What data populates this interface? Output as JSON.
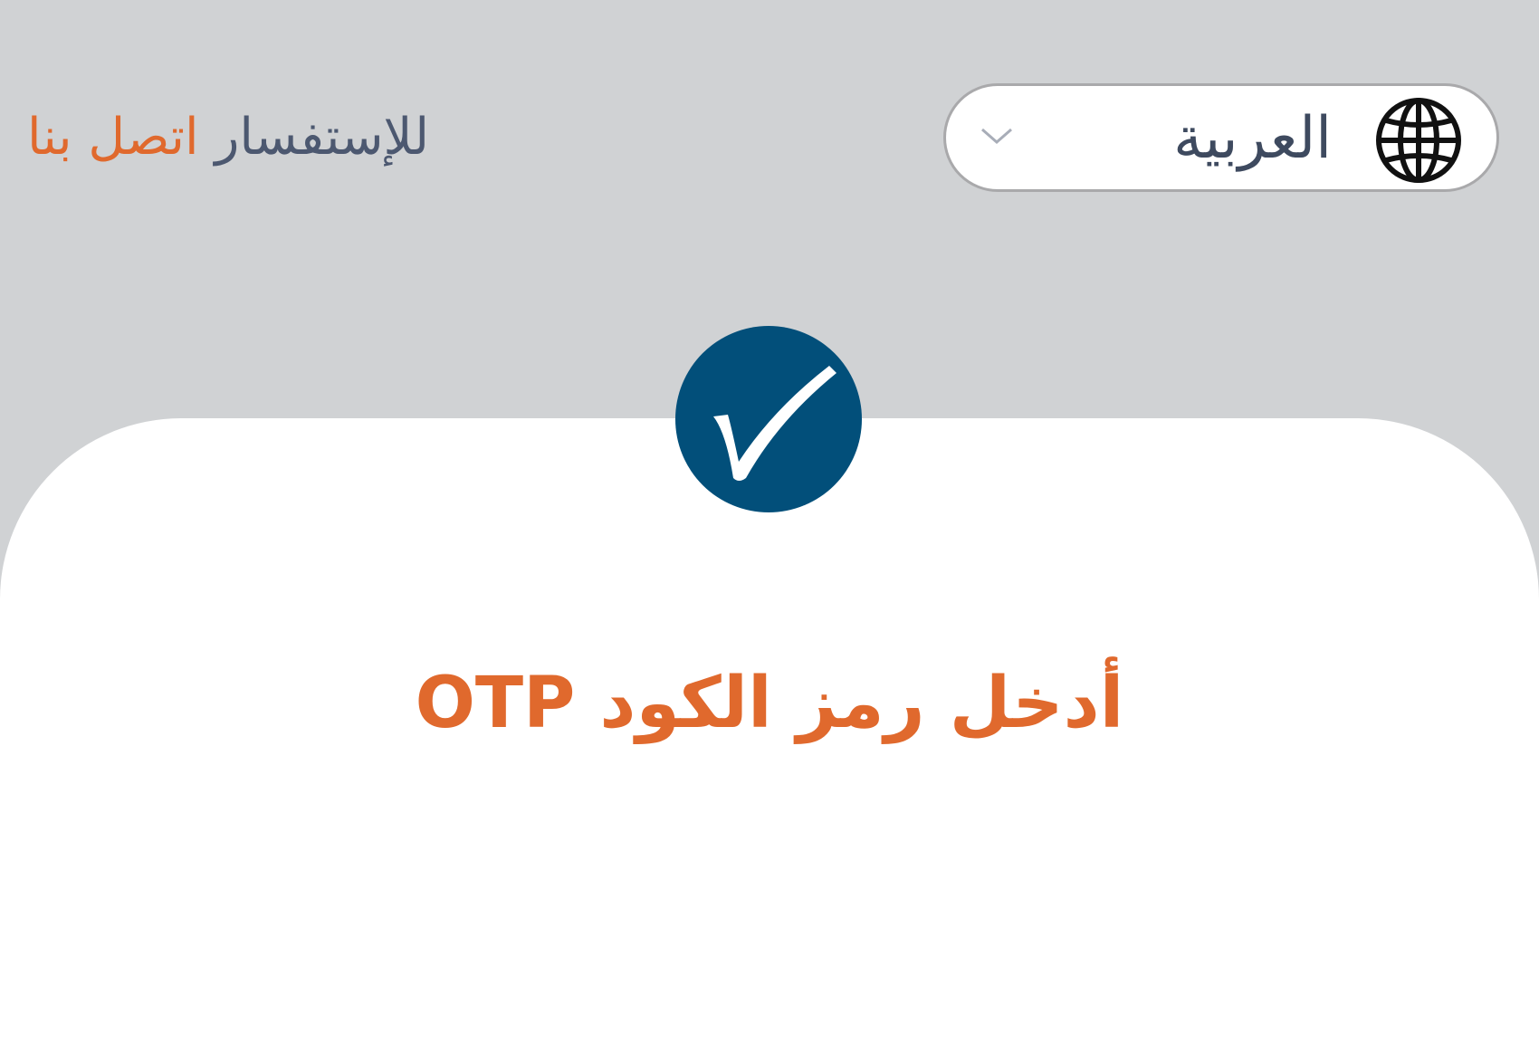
{
  "header": {
    "language_selector": {
      "selected_label": "العربية",
      "globe_icon": "globe-icon",
      "dropdown_icon": "chevron-down-icon"
    },
    "contact": {
      "prefix_text": "للإستفسار",
      "link_text": "اتصل بنا"
    }
  },
  "main": {
    "badge_icon": "checkmark-icon",
    "title": "أدخل رمز الكود OTP"
  },
  "colors": {
    "background": "#d0d2d4",
    "card": "#ffffff",
    "accent_orange": "#e0692d",
    "badge_blue": "#024f7a",
    "text_slate": "#4c5870"
  }
}
